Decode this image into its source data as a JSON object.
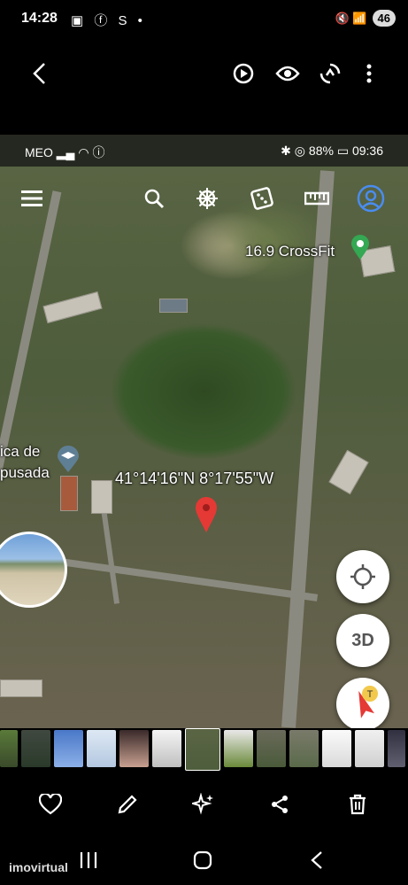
{
  "status_bar": {
    "time": "14:28",
    "left_icons": "▣ ⓕ S •",
    "battery": "46",
    "right_icons": "🔇 📶"
  },
  "viewer": {
    "back_icon": "chevron-left-icon",
    "motion_icon": "motion-photo-icon",
    "eye_icon": "eye-icon",
    "remaster_icon": "remaster-icon",
    "more_icon": "more-vertical-icon"
  },
  "photo": {
    "status_bar": {
      "carrier": "MEO",
      "battery": "88%",
      "time": "09:36"
    },
    "map_toolbar": [
      "menu-icon",
      "search-icon",
      "voyager-wheel-icon",
      "dice-icon",
      "ruler-icon",
      "profile-icon"
    ],
    "poi_crossfit": "16.9 CrossFit",
    "poi_left_line1": "ica de",
    "poi_left_line2": "pusada",
    "coordinates": "41°14'16\"N 8°17'55\"W",
    "button_3d": "3D"
  },
  "actions": [
    "heart-icon",
    "edit-icon",
    "sparkle-icon",
    "share-icon",
    "trash-icon"
  ],
  "watermark": "imovirtual",
  "colors": {
    "pin_red": "#e53935",
    "poi_green": "#34a853",
    "profile_blue": "#4a8cf0"
  }
}
